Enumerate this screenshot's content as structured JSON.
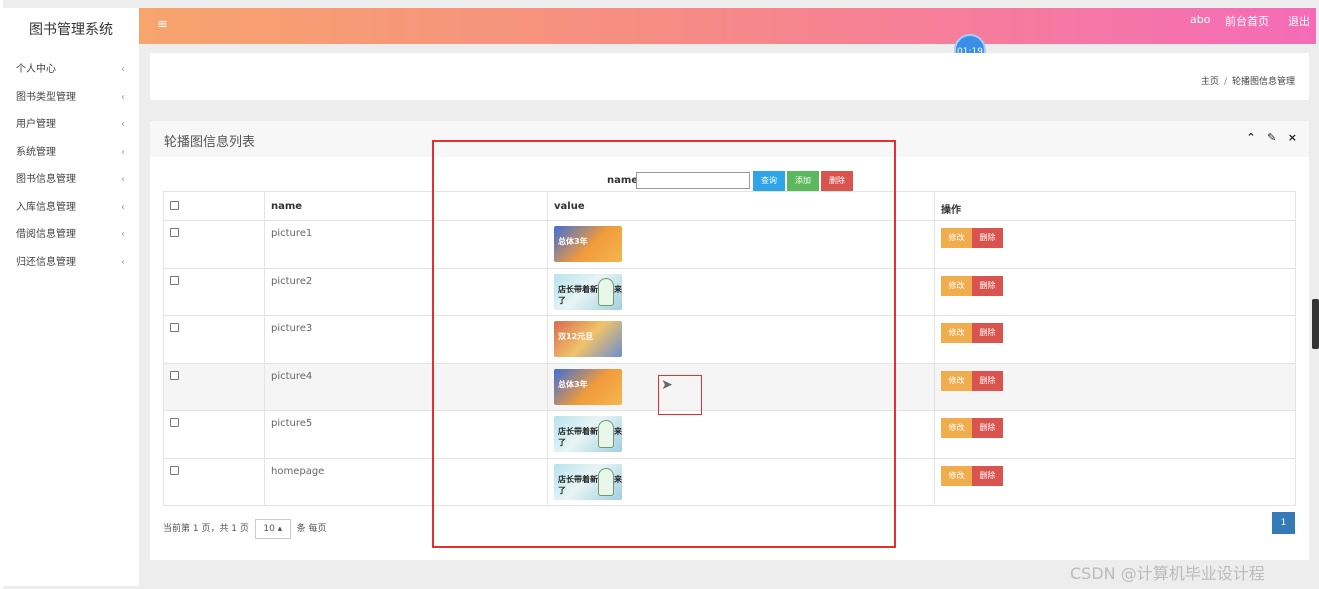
{
  "app": {
    "title": "图书管理系统"
  },
  "sidebar": {
    "items": [
      {
        "label": "个人中心"
      },
      {
        "label": "图书类型管理"
      },
      {
        "label": "用户管理"
      },
      {
        "label": "系统管理"
      },
      {
        "label": "图书信息管理"
      },
      {
        "label": "入库信息管理"
      },
      {
        "label": "借阅信息管理"
      },
      {
        "label": "归还信息管理"
      }
    ],
    "chevron": "‹"
  },
  "topbar": {
    "menu_icon": "≡",
    "user": "abo",
    "home_link": "前台首页",
    "logout": "退出"
  },
  "timer": "01:19",
  "breadcrumb": {
    "home": "主页",
    "separator": "/",
    "current": "轮播图信息管理"
  },
  "panel": {
    "title": "轮播图信息列表",
    "tools": {
      "collapse": "⌃",
      "wrench": "🔧",
      "close": "×"
    }
  },
  "search": {
    "label": "name",
    "value": "",
    "query_label": "查询",
    "add_label": "添加",
    "delete_label": "删除"
  },
  "table": {
    "headers": {
      "name": "name",
      "value": "value",
      "ops": "操作"
    },
    "rows": [
      {
        "name": "picture1",
        "thumb_text": "总体3年"
      },
      {
        "name": "picture2",
        "thumb_text": "店长带着新品走来了"
      },
      {
        "name": "picture3",
        "thumb_text": "双12元旦"
      },
      {
        "name": "picture4",
        "thumb_text": "总体3年"
      },
      {
        "name": "picture5",
        "thumb_text": "店长带着新品走来了"
      },
      {
        "name": "homepage",
        "thumb_text": "店长带着新品走来了"
      }
    ],
    "edit_label": "修改",
    "delete_label": "删除"
  },
  "pagination": {
    "summary": "当前第 1 页，共 1 页",
    "page_size": "10",
    "page_size_suffix": "条 每页",
    "current_page": "1"
  },
  "watermark": "CSDN @计算机毕业设计程",
  "colors": {
    "topbar_start": "#f7a46d",
    "topbar_end": "#f56bb8",
    "query": "#2fa4e7",
    "add": "#5cb85c",
    "delete": "#d9534f",
    "edit": "#f0ad4e",
    "page": "#337ab7",
    "annotation": "#e03030"
  }
}
